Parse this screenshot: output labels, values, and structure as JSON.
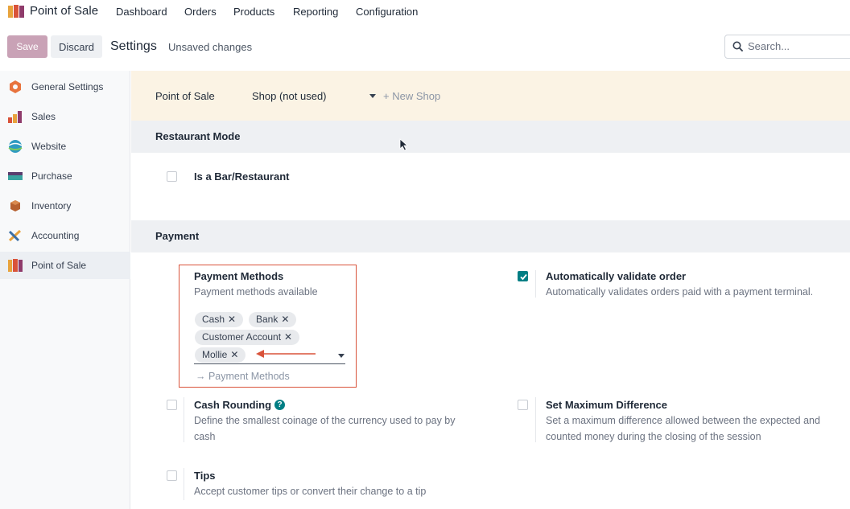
{
  "topnav": {
    "app_name": "Point of Sale",
    "menu": [
      "Dashboard",
      "Orders",
      "Products",
      "Reporting",
      "Configuration"
    ]
  },
  "control_panel": {
    "save_label": "Save",
    "discard_label": "Discard",
    "title": "Settings",
    "status": "Unsaved changes",
    "search_placeholder": "Search..."
  },
  "sidebar": {
    "items": [
      {
        "label": "General Settings",
        "icon": "general-settings-icon",
        "active": false
      },
      {
        "label": "Sales",
        "icon": "sales-icon",
        "active": false
      },
      {
        "label": "Website",
        "icon": "website-icon",
        "active": false
      },
      {
        "label": "Purchase",
        "icon": "purchase-icon",
        "active": false
      },
      {
        "label": "Inventory",
        "icon": "inventory-icon",
        "active": false
      },
      {
        "label": "Accounting",
        "icon": "accounting-icon",
        "active": false
      },
      {
        "label": "Point of Sale",
        "icon": "point-of-sale-icon",
        "active": true
      }
    ]
  },
  "pos_bar": {
    "label": "Point of Sale",
    "shop_value": "Shop (not used)",
    "new_shop": "+ New Shop"
  },
  "restaurant": {
    "section_title": "Restaurant Mode",
    "bar_restaurant": {
      "label": "Is a Bar/Restaurant",
      "checked": false
    }
  },
  "payment": {
    "section_title": "Payment",
    "payment_methods": {
      "title": "Payment Methods",
      "description": "Payment methods available",
      "tags": [
        "Cash",
        "Bank",
        "Customer Account",
        "Mollie"
      ],
      "link": "→ Payment Methods"
    },
    "auto_validate": {
      "title": "Automatically validate order",
      "description": "Automatically validates orders paid with a payment terminal.",
      "checked": true
    },
    "cash_rounding": {
      "title": "Cash Rounding",
      "help": "?",
      "description_line1": "Define the smallest coinage of the currency used to pay by",
      "description_line2": "cash",
      "checked": false
    },
    "max_difference": {
      "title": "Set Maximum Difference",
      "description_line1": "Set a maximum difference allowed between the expected and",
      "description_line2": "counted money during the closing of the session",
      "checked": false
    },
    "tips": {
      "title": "Tips",
      "description": "Accept customer tips or convert their change to a tip",
      "checked": false
    }
  },
  "colors": {
    "brand_primary": "#c9a2b6",
    "accent_teal": "#017e84",
    "highlight_red": "#d9533a",
    "pos_bar_bg": "#fbf3e4"
  }
}
